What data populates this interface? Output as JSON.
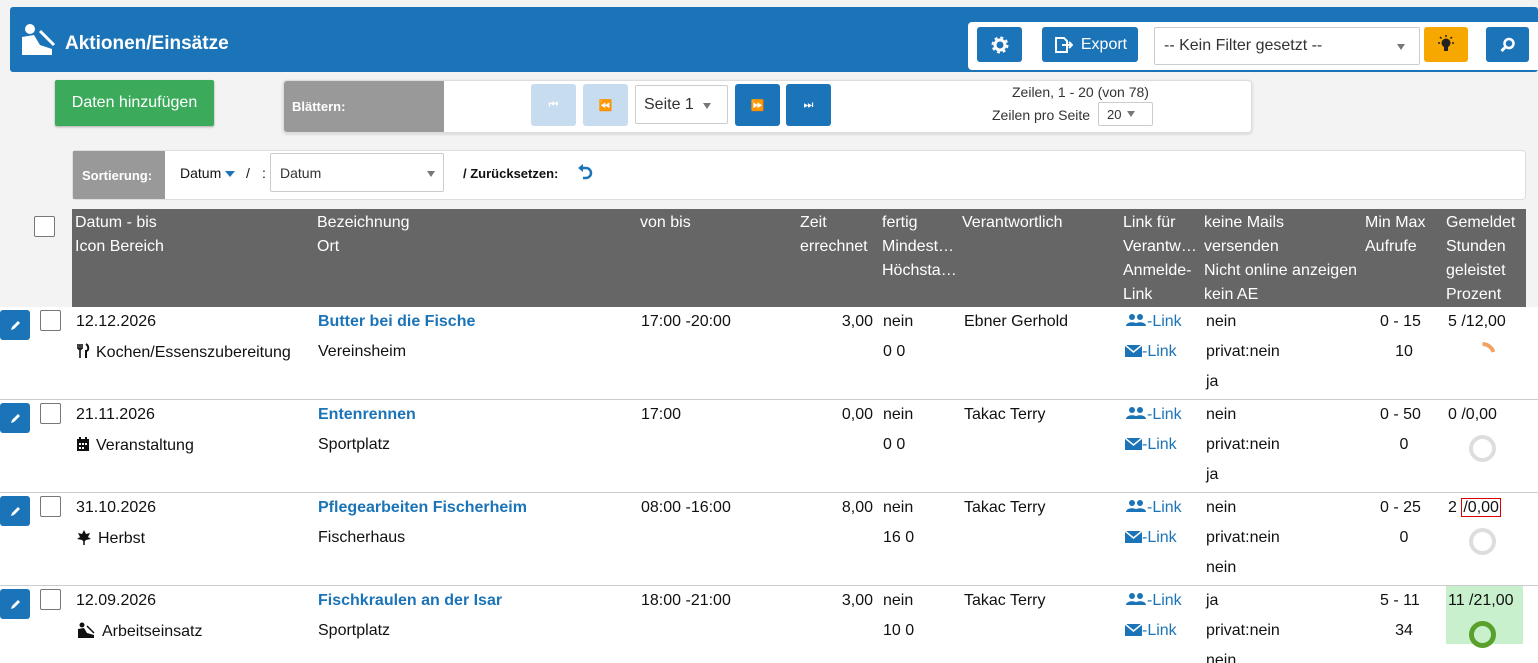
{
  "header": {
    "title": "Aktionen/Einsätze",
    "export_label": "Export",
    "filter_value": "-- Kein Filter gesetzt --"
  },
  "toolbar": {
    "add_label": "Daten hinzufügen"
  },
  "pager": {
    "label": "Blättern:",
    "page_value": "Seite 1",
    "rows_info": "Zeilen, 1 - 20 (von 78)",
    "rows_per_page_label": "Zeilen pro Seite",
    "rows_per_page_value": "20"
  },
  "sort": {
    "label": "Sortierung:",
    "field": "Datum",
    "sep": "/",
    "colon": ":",
    "select_value": "Datum",
    "reset_label": "/ Zurücksetzen:"
  },
  "columns": {
    "c1a": "Datum - bis",
    "c1b": "Icon Bereich",
    "c2a": "Bezeichnung",
    "c2b": "Ort",
    "c3a": "von bis",
    "c4a": "Zeit",
    "c4b": "errechnet",
    "c5a": "fertig",
    "c5b": "Mindest…",
    "c5c": "Höchsta…",
    "c6a": "Verantwortlich",
    "c7a": "Link für",
    "c7b": "Verantw…",
    "c7c": "Anmelde-",
    "c7d": "Link",
    "c8a": "keine Mails",
    "c8b": "versenden",
    "c8c": "Nicht online anzeigen",
    "c8d": "kein AE",
    "c9a": "Min Max",
    "c9b": "Aufrufe",
    "c10a": "Gemeldet",
    "c10b": "Stunden",
    "c10c": "geleistet",
    "c10d": "Prozent"
  },
  "rows": [
    {
      "date": "12.12.2026",
      "area_icon": "utensils-icon",
      "area": "Kochen/Essenszubereitung",
      "name": "Butter bei die Fische",
      "place": "Vereinsheim",
      "time": "17:00  -20:00",
      "hours": "3,00",
      "done": "nein",
      "minmax": "0  0",
      "resp": "Ebner Gerhold",
      "link1": "-Link",
      "link2": "-Link",
      "mail1": "nein",
      "mail2": "privat:nein",
      "mail3": "ja",
      "range": "0  - 15",
      "views": "10",
      "reported": "5  /12,00",
      "pct_color": "#f0a060",
      "pct": 0.2
    },
    {
      "date": "21.11.2026",
      "area_icon": "calendar-icon",
      "area": "Veranstaltung",
      "name": "Entenrennen",
      "place": "Sportplatz",
      "time": "17:00",
      "hours": "0,00",
      "done": "nein",
      "minmax": "0  0",
      "resp": "Takac Terry",
      "link1": "-Link",
      "link2": "-Link",
      "mail1": "nein",
      "mail2": "privat:nein",
      "mail3": "ja",
      "range": "0  - 50",
      "views": "0",
      "reported": "0  /0,00",
      "pct_color": "#dddddd",
      "pct": 0
    },
    {
      "date": "31.10.2026",
      "area_icon": "leaf-icon",
      "area": "Herbst",
      "name": "Pflegearbeiten Fischerheim",
      "place": "Fischerhaus",
      "time": "08:00  -16:00",
      "hours": "8,00",
      "done": "nein",
      "minmax": "16  0",
      "resp": "Takac Terry",
      "link1": "-Link",
      "link2": "-Link",
      "mail1": "nein",
      "mail2": "privat:nein",
      "mail3": "nein",
      "range": "0  - 25",
      "views": "0",
      "reported": "2  /0,00",
      "pct_color": "#dddddd",
      "pct": 0
    },
    {
      "date": "12.09.2026",
      "area_icon": "worker-icon",
      "area": "Arbeitseinsatz",
      "name": "Fischkraulen an der Isar",
      "place": "Sportplatz",
      "time": "18:00  -21:00",
      "hours": "3,00",
      "done": "nein",
      "minmax": "10  0",
      "resp": "Takac Terry",
      "link1": "-Link",
      "link2": "-Link",
      "mail1": "ja",
      "mail2": "privat:nein",
      "mail3": "nein",
      "range": "5  - 11",
      "views": "34",
      "reported": "11  /21,00",
      "pct_color": "#5aa02c",
      "pct": 1
    }
  ]
}
